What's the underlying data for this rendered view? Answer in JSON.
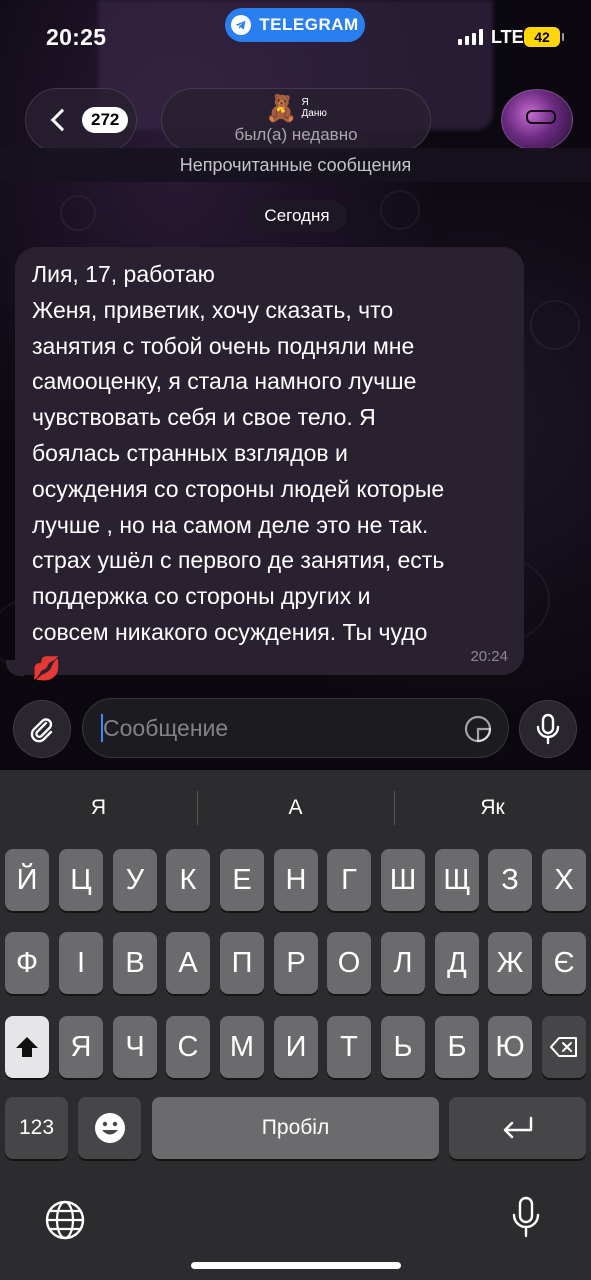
{
  "status_bar": {
    "time": "20:25",
    "app_pill": "TELEGRAM",
    "network": "LTE",
    "battery": "42"
  },
  "header": {
    "unread_count": "272",
    "contact_name_line1": "Я",
    "contact_name_line2": "Даню",
    "contact_emoji": "🧸",
    "status": "был(а) недавно"
  },
  "unread_banner": "Непрочитанные сообщения",
  "date_chip": "Сегодня",
  "message": {
    "text": "Лия, 17, работаю\nЖеня, приветик, хочу сказать, что\nзанятия с тобой очень подняли мне\nсамооценку, я стала намного лучше\nчувствовать себя и свое тело. Я\nбоялась странных взглядов и\nосуждения со стороны людей которые\nлучше , но на самом деле это не так.\nстрах ушёл с первого де занятия, есть\nподдержка со стороны других и\nсовсем никакого осуждения. Ты чудо\n💋",
    "time": "20:24"
  },
  "composer": {
    "placeholder": "Сообщение"
  },
  "keyboard": {
    "suggestions": [
      "Я",
      "А",
      "Як"
    ],
    "row1": [
      "Й",
      "Ц",
      "У",
      "К",
      "Е",
      "Н",
      "Г",
      "Ш",
      "Щ",
      "З",
      "Х"
    ],
    "row2": [
      "Ф",
      "І",
      "В",
      "А",
      "П",
      "Р",
      "О",
      "Л",
      "Д",
      "Ж",
      "Є"
    ],
    "row3": [
      "Я",
      "Ч",
      "С",
      "М",
      "И",
      "Т",
      "Ь",
      "Б",
      "Ю"
    ],
    "numbers_key": "123",
    "space_key": "Пробіл"
  },
  "colors": {
    "accent": "#2a7ff0",
    "battery": "#ffd60a",
    "bubble": "#2a2130",
    "keyboard_bg": "#2c2c2e",
    "key": "#6b6b6e"
  }
}
